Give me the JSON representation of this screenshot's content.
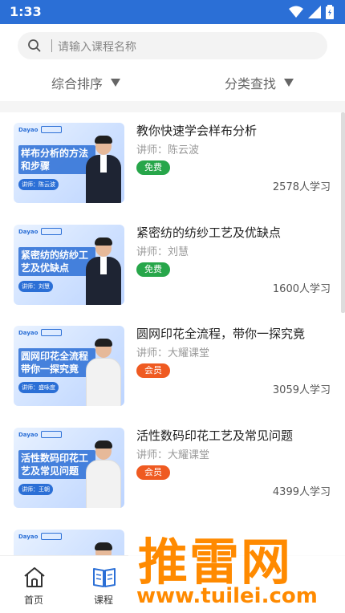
{
  "status_bar": {
    "time": "1:33"
  },
  "search": {
    "placeholder": "请输入课程名称"
  },
  "filters": {
    "sort_label": "综合排序",
    "category_label": "分类查找"
  },
  "courses": [
    {
      "title": "教你快速学会样布分析",
      "lecturer": "讲师：陈云波",
      "tag": "免费",
      "learners": "2578人学习",
      "thumb": {
        "brand": "Dayao",
        "heading": "样布分析的方法和步骤",
        "speaker": "讲师：陈云波",
        "suit": "dark"
      }
    },
    {
      "title": "紧密纺的纺纱工艺及优缺点",
      "lecturer": "讲师：刘慧",
      "tag": "免费",
      "learners": "1600人学习",
      "thumb": {
        "brand": "Dayao",
        "heading": "紧密纺的纺纱工艺及优缺点",
        "speaker": "讲师：刘慧",
        "suit": "dark"
      }
    },
    {
      "title": "圆网印花全流程，带你一探究竟",
      "lecturer": "讲师：大耀课堂",
      "tag": "会员",
      "learners": "3059人学习",
      "thumb": {
        "brand": "Dayao",
        "heading": "圆网印花全流程带你一探究竟",
        "speaker": "讲师：盛咏度",
        "suit": "light"
      }
    },
    {
      "title": "活性数码印花工艺及常见问题",
      "lecturer": "讲师：大耀课堂",
      "tag": "会员",
      "learners": "4399人学习",
      "thumb": {
        "brand": "Dayao",
        "heading": "活性数码印花工艺及常见问题",
        "speaker": "讲师：王朝",
        "suit": "light"
      }
    },
    {
      "title": "",
      "lecturer": "",
      "tag": "",
      "learners": "",
      "thumb": {
        "brand": "Dayao",
        "heading": "",
        "speaker": "",
        "suit": "dark"
      }
    }
  ],
  "tabbar": {
    "home": "首页",
    "courses": "课程"
  },
  "watermark": {
    "big": "推雷网",
    "small": "www.tuilei.com"
  },
  "colors": {
    "accent": "#2b6fd6",
    "free": "#27a64a",
    "vip": "#ef5a21",
    "watermark": "#ff8a00"
  }
}
